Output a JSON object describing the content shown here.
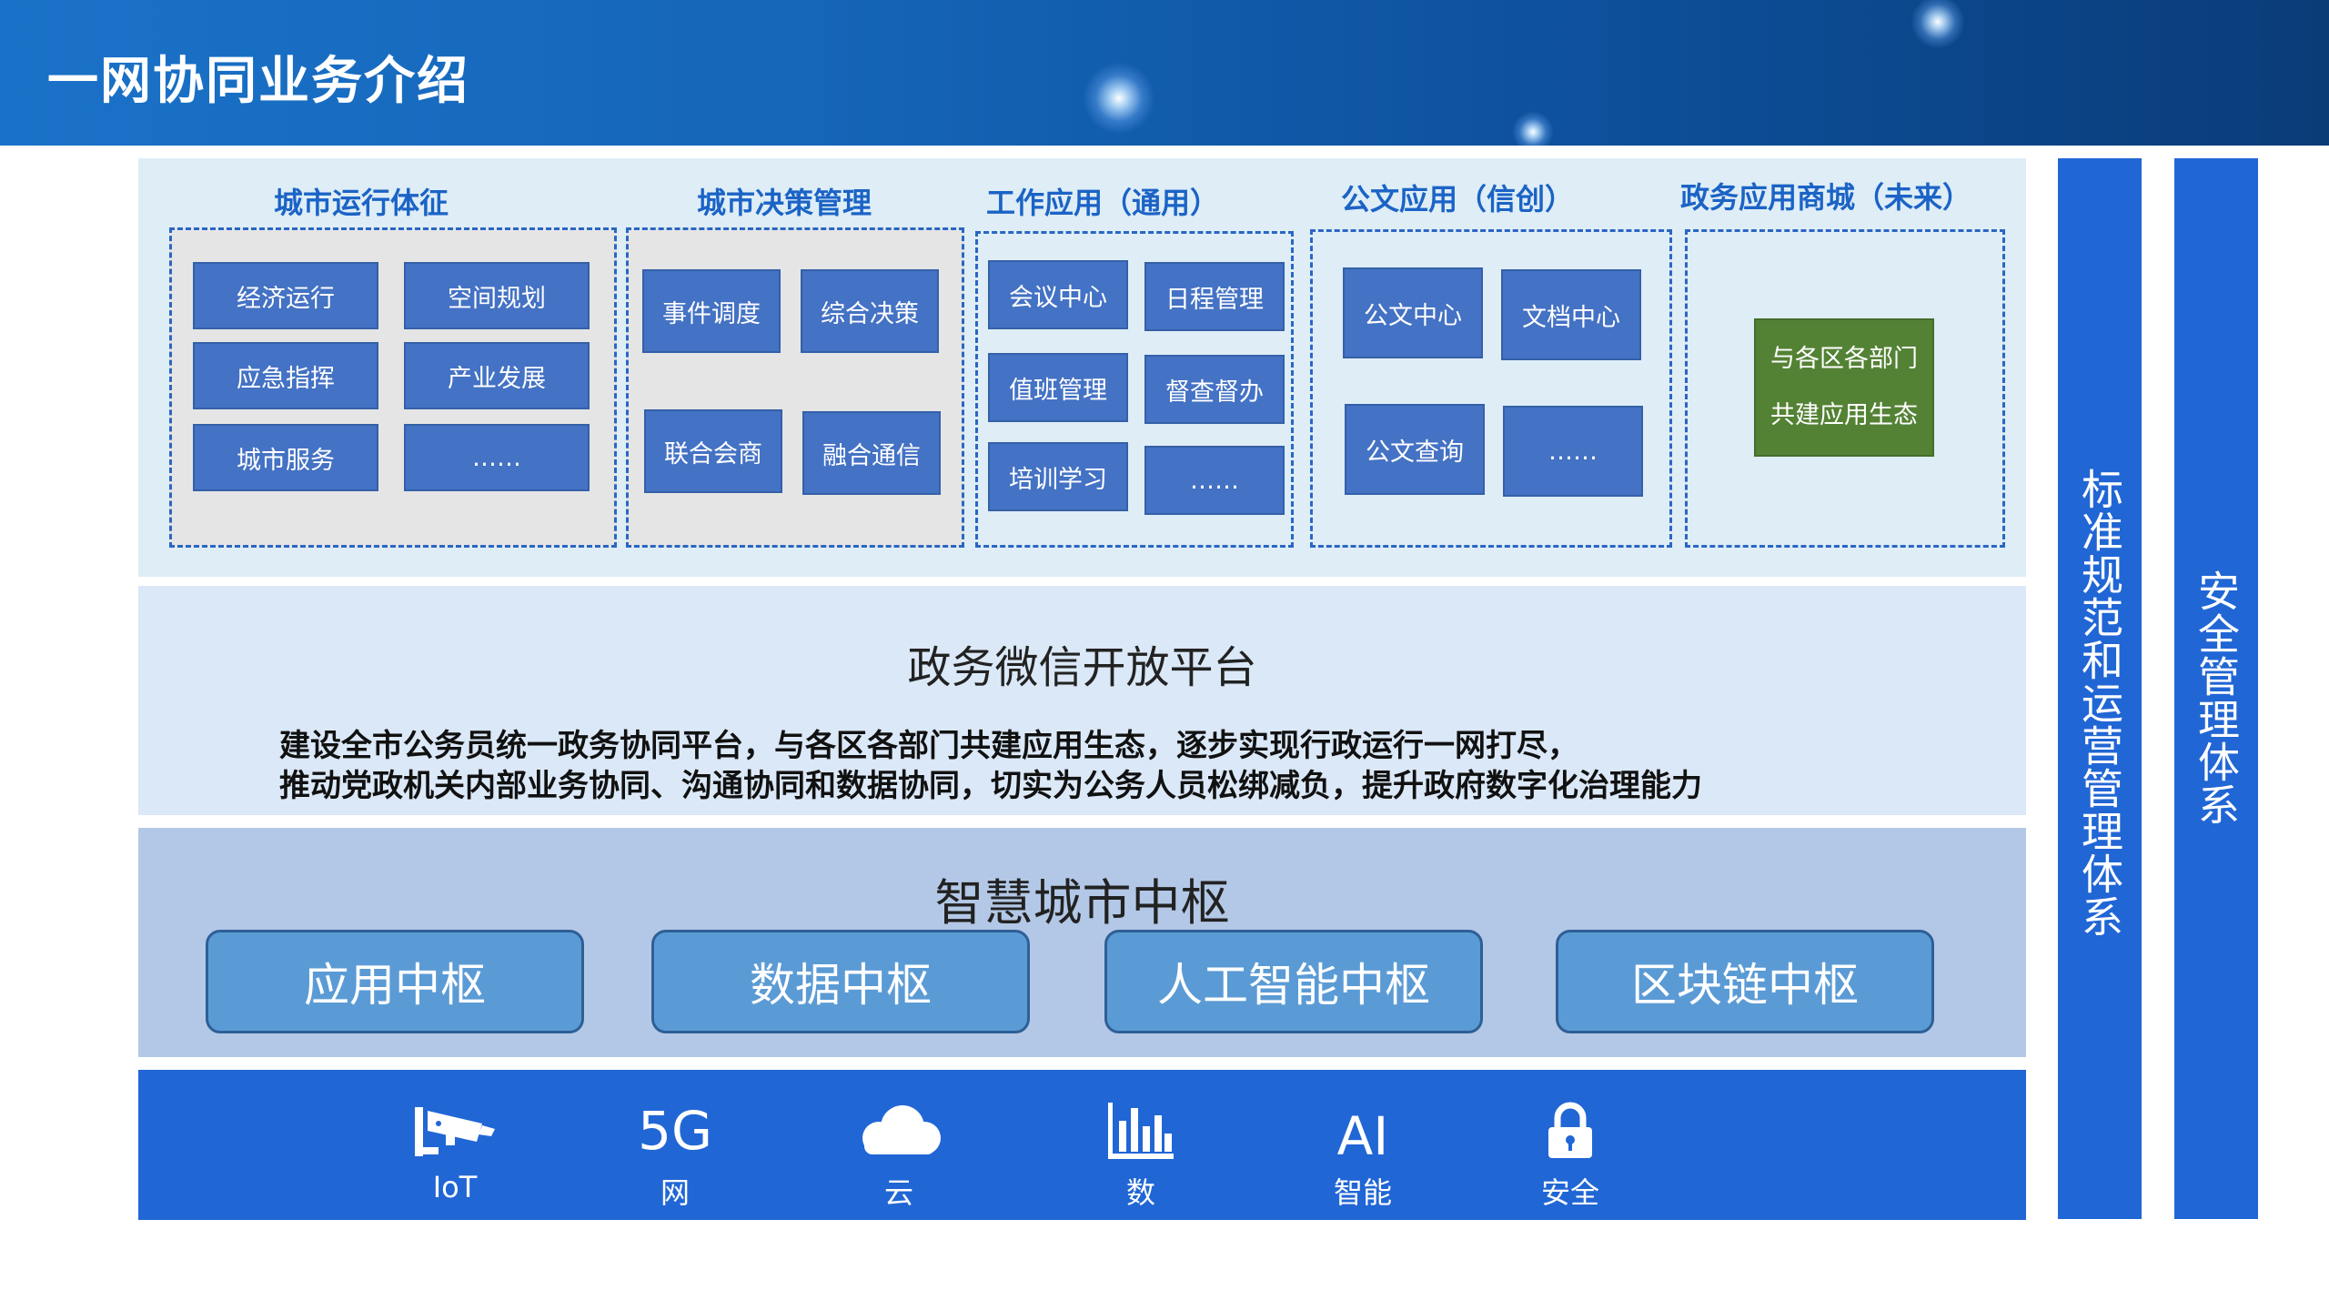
{
  "header": {
    "title": "一网协同业务介绍"
  },
  "groups": [
    {
      "title": "城市运行体征",
      "items": [
        "经济运行",
        "空间规划",
        "应急指挥",
        "产业发展",
        "城市服务",
        "……"
      ]
    },
    {
      "title": "城市决策管理",
      "items": [
        "事件调度",
        "综合决策",
        "联合会商",
        "融合通信"
      ]
    },
    {
      "title": "工作应用（通用）",
      "items": [
        "会议中心",
        "日程管理",
        "值班管理",
        "督查督办",
        "培训学习",
        "……"
      ]
    },
    {
      "title": "公文应用（信创）",
      "items": [
        "公文中心",
        "文档中心",
        "公文查询",
        "……"
      ]
    },
    {
      "title": "政务应用商城（未来）",
      "items": [
        "与各区各部门",
        "共建应用生态"
      ]
    }
  ],
  "platform": {
    "title": "政务微信开放平台",
    "desc_line1": "建设全市公务员统一政务协同平台，与各区各部门共建应用生态，逐步实现行政运行一网打尽，",
    "desc_line2": "推动党政机关内部业务协同、沟通协同和数据协同，切实为公务人员松绑减负，提升政府数字化治理能力"
  },
  "hub": {
    "title": "智慧城市中枢",
    "items": [
      "应用中枢",
      "数据中枢",
      "人工智能中枢",
      "区块链中枢"
    ]
  },
  "infra": [
    {
      "label": "IoT",
      "icon": "camera-icon"
    },
    {
      "label": "网",
      "icon": "5g-text",
      "text": "5G"
    },
    {
      "label": "云",
      "icon": "cloud-icon"
    },
    {
      "label": "数",
      "icon": "bar-chart-icon"
    },
    {
      "label": "智能",
      "icon": "ai-text",
      "text": "AI"
    },
    {
      "label": "安全",
      "icon": "lock-icon"
    }
  ],
  "side_bars": [
    "标准规范和运营管理体系",
    "安全管理体系"
  ],
  "colors": {
    "header_blue": "#1565b8",
    "tile_blue": "#4472c4",
    "tile_green": "#548235",
    "title_blue": "#1b63c6",
    "bar_blue": "#2166d5",
    "hub_button": "#5b9bd5"
  }
}
